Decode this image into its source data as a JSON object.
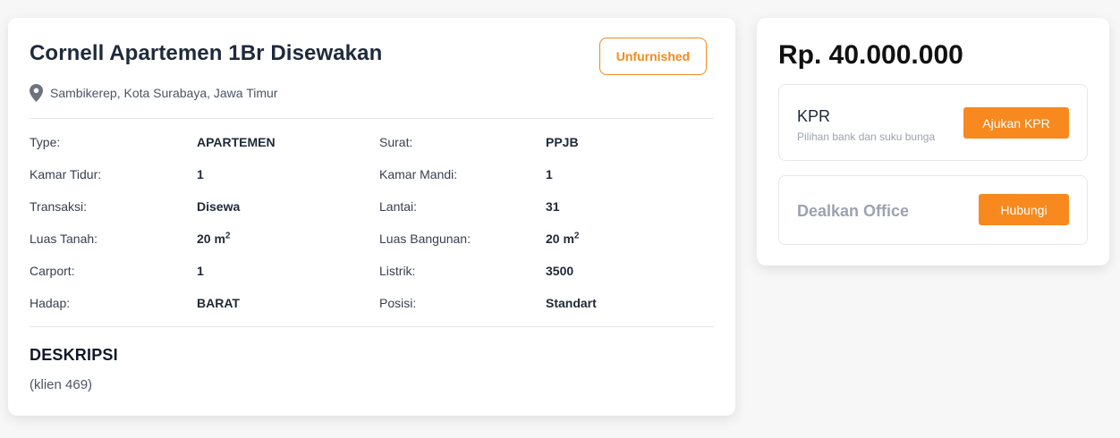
{
  "listing": {
    "title": "Cornell Apartemen 1Br Disewakan",
    "furnishing_badge": "Unfurnished",
    "location": "Sambikerep, Kota Surabaya, Jawa Timur",
    "location_icon": "map-pin-icon"
  },
  "specs": [
    {
      "label": "Type:",
      "value": "APARTEMEN",
      "sup": ""
    },
    {
      "label": "Surat:",
      "value": "PPJB",
      "sup": ""
    },
    {
      "label": "Kamar Tidur:",
      "value": "1",
      "sup": ""
    },
    {
      "label": "Kamar Mandi:",
      "value": "1",
      "sup": ""
    },
    {
      "label": "Transaksi:",
      "value": "Disewa",
      "sup": ""
    },
    {
      "label": "Lantai:",
      "value": "31",
      "sup": ""
    },
    {
      "label": "Luas Tanah:",
      "value": "20 m",
      "sup": "2"
    },
    {
      "label": "Luas Bangunan:",
      "value": "20 m",
      "sup": "2"
    },
    {
      "label": "Carport:",
      "value": "1",
      "sup": ""
    },
    {
      "label": "Listrik:",
      "value": "3500",
      "sup": ""
    },
    {
      "label": "Hadap:",
      "value": "BARAT",
      "sup": ""
    },
    {
      "label": "Posisi:",
      "value": "Standart",
      "sup": ""
    }
  ],
  "description": {
    "heading": "DESKRIPSI",
    "text": "(klien 469)"
  },
  "sidebar": {
    "price": "Rp. 40.000.000",
    "kpr": {
      "title": "KPR",
      "subtitle": "Pilihan bank dan suku bunga",
      "button_label": "Ajukan KPR"
    },
    "office": {
      "name": "Dealkan Office",
      "button_label": "Hubungi"
    }
  },
  "colors": {
    "accent": "#f7891f",
    "title": "#1e2a3b",
    "muted": "#9ca3af"
  }
}
